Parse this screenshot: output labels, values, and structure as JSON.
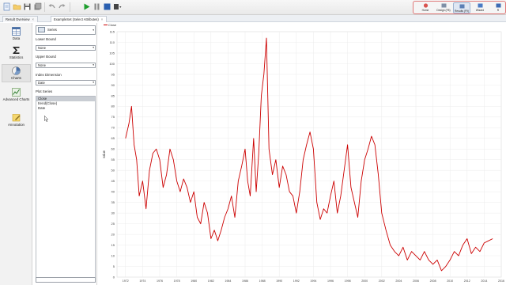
{
  "toolbar": {
    "buttons": [
      {
        "name": "new-process-icon",
        "color": "#6d8fc2"
      },
      {
        "name": "open-folder-icon",
        "color": "#e8b84a"
      },
      {
        "name": "save-icon",
        "color": "#5a5a5a"
      },
      {
        "name": "save-as-icon",
        "color": "#7a7a7a"
      },
      {
        "name": "undo-icon",
        "color": "#9a9a9a"
      },
      {
        "name": "redo-icon",
        "color": "#9a9a9a"
      },
      {
        "name": "run-icon",
        "color": "#1e9e2e"
      },
      {
        "name": "pause-icon",
        "color": "#8a8a8a"
      },
      {
        "name": "stop-icon",
        "color": "#2a5fb0"
      },
      {
        "name": "more-icon",
        "color": "#444444"
      }
    ],
    "perspectives": [
      {
        "label": "Home",
        "key": "home",
        "active": false
      },
      {
        "label": "Design (F8)",
        "key": "design",
        "active": false
      },
      {
        "label": "Results (F9)",
        "key": "results",
        "active": true
      },
      {
        "label": "Wizard",
        "key": "wizard",
        "active": false
      },
      {
        "label": "R",
        "key": "r",
        "active": false
      }
    ]
  },
  "tabs": [
    {
      "label": "Result Overview",
      "close": "×",
      "active": false
    },
    {
      "label": "ExampleSet (Select Attributes)",
      "close": "×",
      "active": true
    }
  ],
  "sidebar": {
    "items": [
      {
        "label": "Data",
        "icon": "table-icon",
        "active": false
      },
      {
        "label": "Statistics",
        "icon": "sigma-icon",
        "active": false
      },
      {
        "label": "Charts",
        "icon": "chart-icon",
        "active": true
      },
      {
        "label": "Advanced Charts",
        "icon": "advanced-chart-icon",
        "active": false
      },
      {
        "label": "Annotation",
        "icon": "annotation-icon",
        "active": false
      }
    ]
  },
  "config": {
    "plot_type": "Series",
    "lower_bound_label": "Lower Bound",
    "lower_bound_value": "None",
    "upper_bound_label": "Upper Bound",
    "upper_bound_value": "None",
    "index_dimension_label": "Index Dimension",
    "index_dimension_value": "Date",
    "plot_series_label": "Plot Series",
    "series": [
      {
        "label": "Close",
        "selected": true
      },
      {
        "label": "trend(Close)",
        "selected": false
      },
      {
        "label": "Date",
        "selected": false
      }
    ]
  },
  "chart_data": {
    "type": "line",
    "legend": "Close",
    "ylabel": "value",
    "xlabel": "",
    "xlim": [
      1971,
      2016
    ],
    "ylim": [
      0,
      115
    ],
    "yticks": [
      0,
      5,
      10,
      15,
      20,
      25,
      30,
      35,
      40,
      45,
      50,
      55,
      60,
      65,
      70,
      75,
      80,
      85,
      90,
      95,
      100,
      105,
      110,
      115
    ],
    "xticks": [
      1972,
      1974,
      1976,
      1978,
      1980,
      1982,
      1984,
      1986,
      1988,
      1990,
      1992,
      1994,
      1996,
      1998,
      2000,
      2002,
      2004,
      2006,
      2008,
      2010,
      2012,
      2014,
      2016
    ],
    "line_color": "#cc0000",
    "grid": true,
    "series": [
      {
        "name": "Close",
        "x": [
          1972.0,
          1972.4,
          1972.7,
          1973.0,
          1973.3,
          1973.6,
          1974.0,
          1974.4,
          1974.8,
          1975.2,
          1975.6,
          1976.0,
          1976.4,
          1976.8,
          1977.2,
          1977.6,
          1978.0,
          1978.4,
          1978.8,
          1979.2,
          1979.6,
          1980.0,
          1980.4,
          1980.8,
          1981.2,
          1981.6,
          1982.0,
          1982.4,
          1982.8,
          1983.2,
          1983.6,
          1984.0,
          1984.4,
          1984.8,
          1985.2,
          1985.6,
          1986.0,
          1986.3,
          1986.6,
          1987.0,
          1987.3,
          1987.6,
          1987.9,
          1988.2,
          1988.5,
          1988.8,
          1989.2,
          1989.6,
          1990.0,
          1990.4,
          1990.8,
          1991.2,
          1991.6,
          1992.0,
          1992.4,
          1992.8,
          1993.2,
          1993.6,
          1994.0,
          1994.4,
          1994.8,
          1995.2,
          1995.6,
          1996.0,
          1996.4,
          1996.8,
          1997.2,
          1997.6,
          1998.0,
          1998.4,
          1998.8,
          1999.2,
          1999.6,
          2000.0,
          2000.4,
          2000.8,
          2001.2,
          2001.6,
          2002.0,
          2002.5,
          2003.0,
          2003.5,
          2004.0,
          2004.5,
          2005.0,
          2005.5,
          2006.0,
          2006.5,
          2007.0,
          2007.5,
          2008.0,
          2008.5,
          2009.0,
          2009.5,
          2010.0,
          2010.5,
          2011.0,
          2011.5,
          2012.0,
          2012.5,
          2013.0,
          2013.5,
          2014.0,
          2014.5,
          2015.0
        ],
        "y": [
          65,
          72,
          80,
          62,
          55,
          38,
          45,
          32,
          50,
          58,
          60,
          55,
          42,
          48,
          60,
          55,
          45,
          40,
          46,
          42,
          35,
          40,
          28,
          25,
          35,
          30,
          18,
          22,
          17,
          22,
          28,
          32,
          38,
          28,
          45,
          52,
          60,
          45,
          38,
          65,
          40,
          58,
          85,
          95,
          112,
          60,
          48,
          55,
          42,
          52,
          48,
          40,
          38,
          30,
          40,
          55,
          62,
          68,
          60,
          35,
          27,
          32,
          30,
          38,
          45,
          30,
          38,
          50,
          62,
          42,
          35,
          28,
          45,
          55,
          60,
          66,
          62,
          48,
          30,
          22,
          15,
          12,
          10,
          14,
          8,
          12,
          10,
          8,
          12,
          8,
          6,
          8,
          3,
          5,
          8,
          12,
          10,
          15,
          18,
          11,
          14,
          12,
          16,
          17,
          18
        ]
      }
    ]
  }
}
